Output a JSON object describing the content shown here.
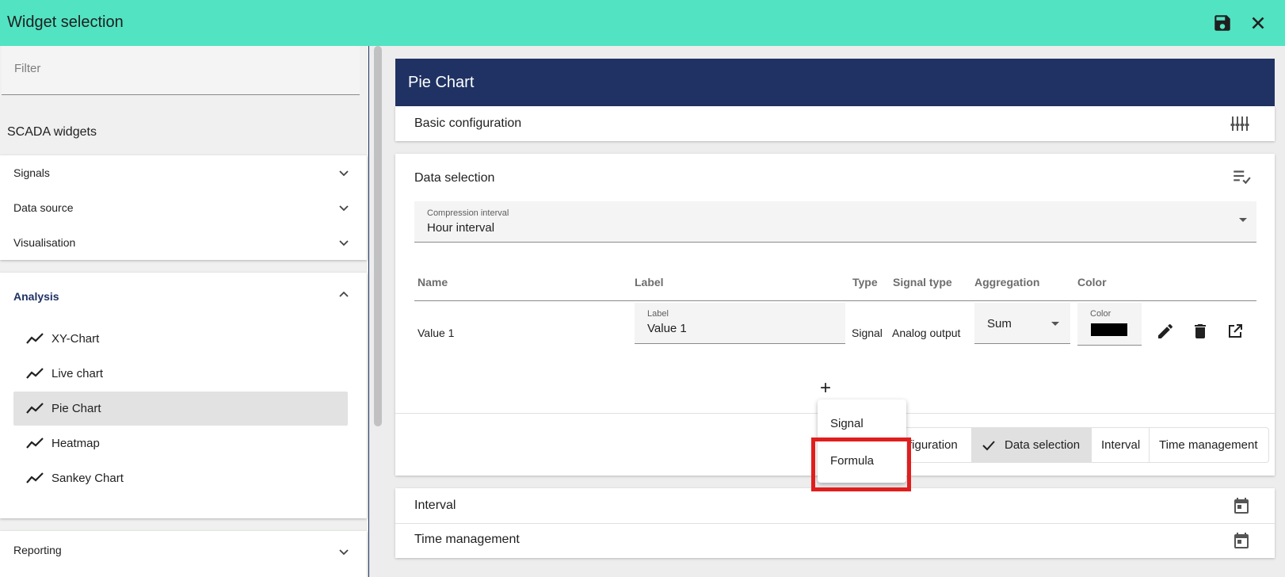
{
  "title": "Widget selection",
  "titlebar": {
    "save_icon": "save-icon",
    "close_icon": "close-icon"
  },
  "sidebar": {
    "filter_placeholder": "Filter",
    "section_title": "SCADA widgets",
    "groups": [
      {
        "label": "Signals",
        "expanded": false
      },
      {
        "label": "Data source",
        "expanded": false
      },
      {
        "label": "Visualisation",
        "expanded": false
      }
    ],
    "analysis": {
      "label": "Analysis",
      "expanded": true,
      "items": [
        {
          "label": "XY-Chart",
          "icon": "line-chart-icon"
        },
        {
          "label": "Live chart",
          "icon": "line-chart-icon"
        },
        {
          "label": "Pie Chart",
          "icon": "line-chart-icon",
          "selected": true
        },
        {
          "label": "Heatmap",
          "icon": "line-chart-icon"
        },
        {
          "label": "Sankey Chart",
          "icon": "line-chart-icon"
        }
      ]
    },
    "reporting": {
      "label": "Reporting",
      "expanded": false
    }
  },
  "main": {
    "widget_title": "Pie Chart",
    "basic_configuration": {
      "label": "Basic configuration",
      "icon": "tune-icon"
    },
    "data_selection": {
      "label": "Data selection",
      "icon": "playlist-check-icon",
      "compression": {
        "label": "Compression interval",
        "value": "Hour interval"
      },
      "columns": [
        "Name",
        "Label",
        "Type",
        "Signal type",
        "Aggregation",
        "Color"
      ],
      "rows": [
        {
          "name": "Value 1",
          "label_field_label": "Label",
          "label_value": "Value 1",
          "type": "Signal",
          "signal_type": "Analog output",
          "aggregation": "Sum",
          "color_label": "Color",
          "color": "#000000"
        }
      ],
      "add_symbol": "+",
      "steps": [
        "Basic configuration",
        "Data selection",
        "Interval",
        "Time management"
      ],
      "visible_step_fragment": "figuration",
      "active_step": "Data selection"
    },
    "interval": {
      "label": "Interval",
      "icon": "calendar-icon"
    },
    "time_management": {
      "label": "Time management",
      "icon": "calendar-icon"
    }
  },
  "add_menu": {
    "items": [
      "Signal",
      "Formula"
    ],
    "highlighted": "Formula",
    "highlight_color": "#e01e1e"
  },
  "colors": {
    "titlebar": "#52e3c2",
    "header": "#1f3263",
    "accent": "#1f3263"
  }
}
